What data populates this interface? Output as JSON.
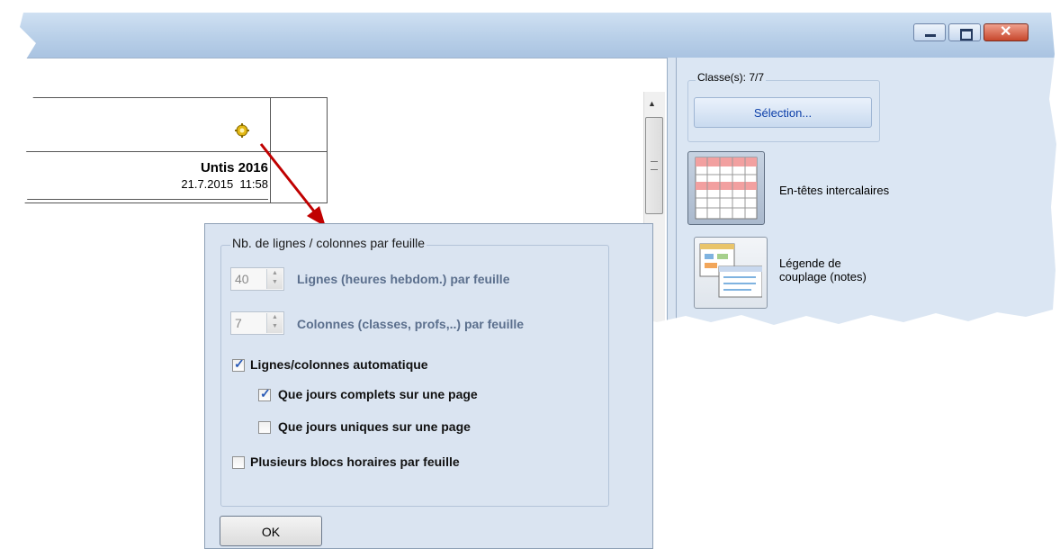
{
  "window": {
    "controls": {
      "minimize": "minimize-icon",
      "maximize": "maximize-icon",
      "close": "close-icon"
    }
  },
  "preview": {
    "product": "Untis 2016",
    "datetime": "21.7.2015  11:58",
    "settings_icon": "gear-icon"
  },
  "right_panel": {
    "classes_legend": "Classe(s): 7/7",
    "selection_button": "Sélection...",
    "header_tabs_label": "En-têtes intercalaires",
    "coupling_legend_label_line1": "Légende de",
    "coupling_legend_label_line2": "couplage (notes)"
  },
  "dialog": {
    "group_title": "Nb. de lignes / colonnes par feuille",
    "rows_value": "40",
    "rows_label": "Lignes (heures hebdom.) par feuille",
    "cols_value": "7",
    "cols_label": "Colonnes (classes, profs,..) par feuille",
    "options": [
      {
        "label": "Lignes/colonnes automatique",
        "checked": true
      },
      {
        "label": "Que jours complets sur une page",
        "checked": true
      },
      {
        "label": "Que jours uniques sur une page",
        "checked": false
      },
      {
        "label": "Plusieurs blocs horaires par feuille",
        "checked": false
      }
    ],
    "ok_button": "OK"
  },
  "colors": {
    "accent_arrow": "#c00000",
    "dialog_bg": "#dae4f1",
    "selection_text": "#0b3ea8"
  }
}
